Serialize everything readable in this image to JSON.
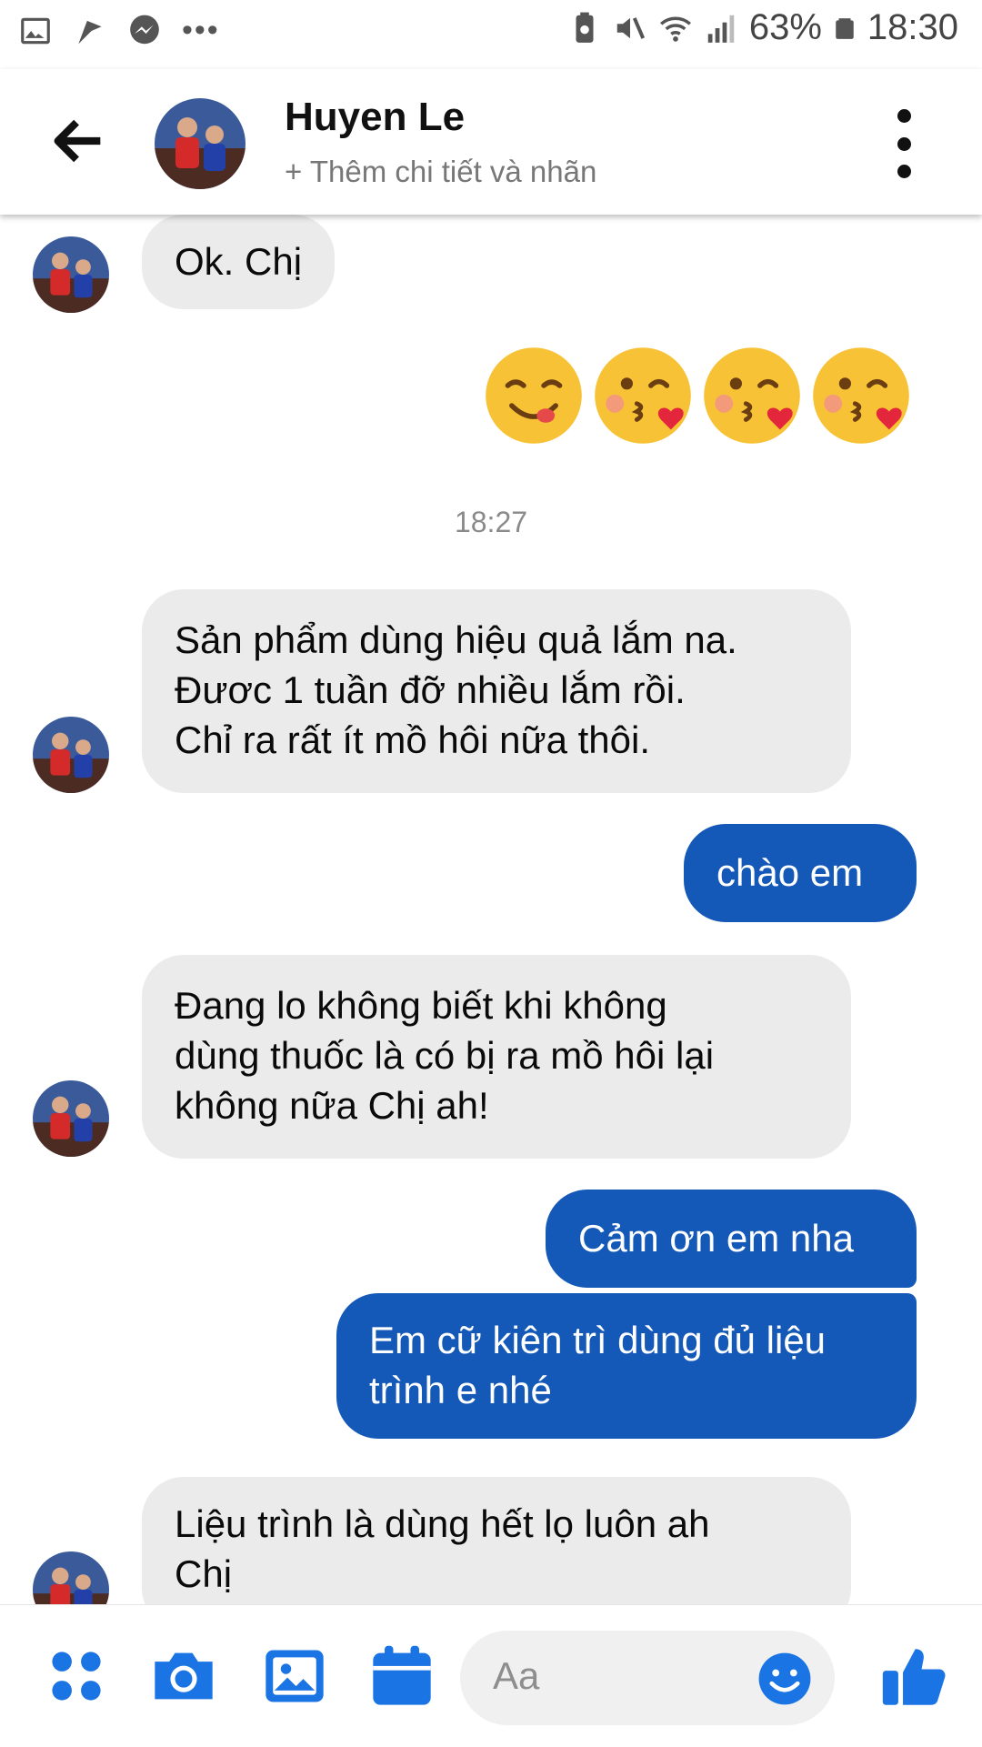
{
  "status_bar": {
    "battery": "63%",
    "time": "18:30",
    "overflow": "•••",
    "icons_left": [
      "gallery-icon",
      "flag-icon",
      "messenger-icon"
    ],
    "icons_right": [
      "battery-saver-icon",
      "mute-icon",
      "wifi-icon",
      "signal-icon",
      "battery-icon"
    ]
  },
  "header": {
    "contact_name": "Huyen Le",
    "subtitle": "+ Thêm chi tiết và nhãn"
  },
  "messages": [
    {
      "from": "contact",
      "text": "Ok. Chị"
    },
    {
      "from": "me",
      "type": "emoji",
      "emojis": [
        "😋",
        "😘",
        "😘",
        "😘"
      ]
    },
    {
      "type": "timestamp",
      "text": "18:27"
    },
    {
      "from": "contact",
      "text": "Sản phẩm dùng hiệu quả lắm na.\nĐươc 1 tuần đỡ nhiều lắm rồi.\nChỉ ra rất ít mồ hôi nữa thôi."
    },
    {
      "from": "me",
      "text": "chào em"
    },
    {
      "from": "contact",
      "text": "Đang lo không biết  khi không\ndùng thuốc là có bị ra mồ hôi lại\nkhông nữa Chị ah!"
    },
    {
      "from": "me",
      "text": "Cảm ơn em nha"
    },
    {
      "from": "me",
      "text": "Em cữ kiên trì dùng đủ liệu\ntrình e nhé"
    },
    {
      "from": "contact",
      "text": "Liệu trình là dùng hết lọ luôn ah\nChị"
    }
  ],
  "composer": {
    "placeholder": "Aa",
    "buttons": [
      "apps-icon",
      "camera-icon",
      "gallery-icon",
      "calendar-icon",
      "emoji-icon",
      "like-icon"
    ]
  },
  "colors": {
    "outgoing_bubble": "#1458b8",
    "incoming_bubble": "#ebebeb",
    "accent": "#1b74e4"
  }
}
